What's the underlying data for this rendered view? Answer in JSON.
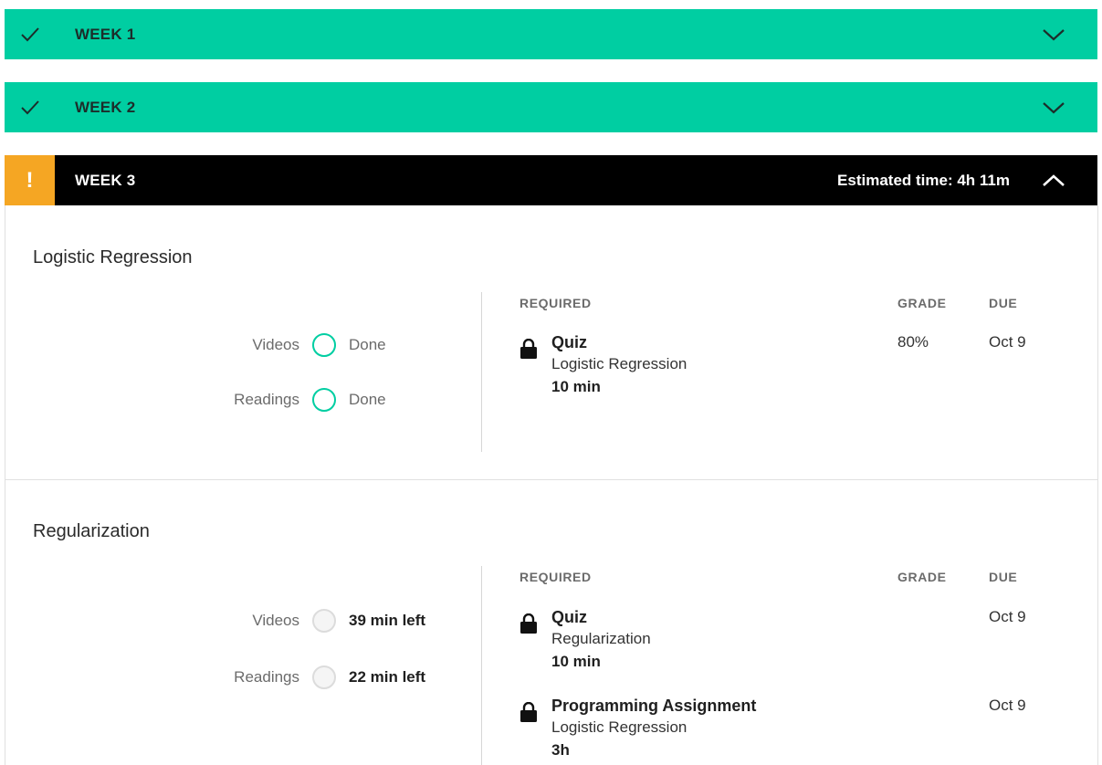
{
  "weeks": [
    {
      "title": "WEEK 1",
      "status_icon": "check-icon",
      "chevron": "chevron-down-icon"
    },
    {
      "title": "WEEK 2",
      "status_icon": "check-icon",
      "chevron": "chevron-up-icon"
    },
    {
      "title": "WEEK 3",
      "status_icon": "!",
      "estimated_time": "Estimated time: 4h 11m",
      "chevron": "chevron-up-icon"
    }
  ],
  "columns": {
    "required": "REQUIRED",
    "grade": "GRADE",
    "due": "DUE"
  },
  "lessons": [
    {
      "title": "Logistic Regression",
      "progress": [
        {
          "label": "Videos",
          "value": "Done",
          "state": "done"
        },
        {
          "label": "Readings",
          "value": "Done",
          "state": "done"
        }
      ],
      "items": [
        {
          "type": "Quiz",
          "subtitle": "Logistic Regression",
          "duration": "10 min",
          "grade": "80%",
          "due": "Oct 9"
        }
      ]
    },
    {
      "title": "Regularization",
      "progress": [
        {
          "label": "Videos",
          "value": "39 min left",
          "state": "todo"
        },
        {
          "label": "Readings",
          "value": "22 min left",
          "state": "todo"
        }
      ],
      "items": [
        {
          "type": "Quiz",
          "subtitle": "Regularization",
          "duration": "10 min",
          "grade": "",
          "due": "Oct 9"
        },
        {
          "type": "Programming Assignment",
          "subtitle": "Logistic Regression",
          "duration": "3h",
          "grade": "",
          "due": "Oct 9"
        }
      ]
    }
  ],
  "colors": {
    "done_green": "#00cea2",
    "warning_orange": "#f5a623",
    "active_black": "#000000"
  }
}
